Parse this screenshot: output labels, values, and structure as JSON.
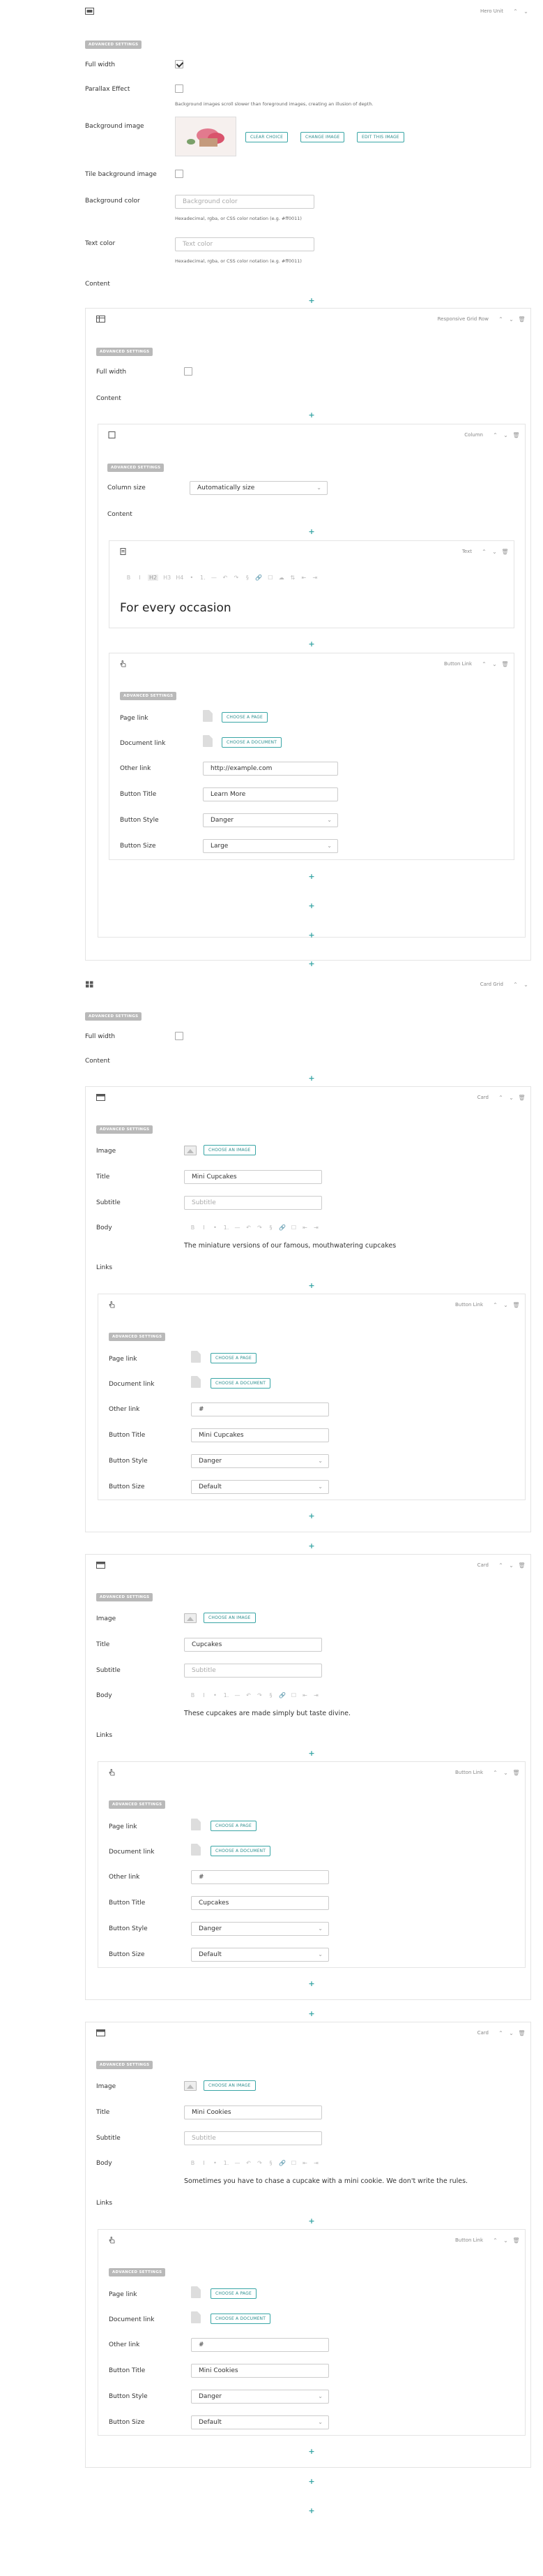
{
  "icons": {
    "controls": [
      "chevron-up-icon",
      "chevron-down-icon",
      "trash-icon"
    ]
  },
  "hero": {
    "type": "Hero Unit",
    "adv": "ADVANCED SETTINGS",
    "full_width": "Full width",
    "parallax": "Parallax Effect",
    "parallax_help": "Background images scroll slower than foreground images, creating an illusion of depth.",
    "bg_image": "Background image",
    "clear": "CLEAR CHOICE",
    "change": "CHANGE IMAGE",
    "edit": "EDIT THIS IMAGE",
    "tile": "Tile background image",
    "bg_color": "Background color",
    "bg_color_ph": "Background color",
    "color_help": "Hexadecimal, rgba, or CSS color notation (e.g. #ff0011)",
    "text_color": "Text color",
    "text_color_ph": "Text color",
    "text_help": "Hexadecimal, rgba, or CSS color notation (e.g. #ff0011)",
    "content": "Content"
  },
  "grid": {
    "type": "Responsive Grid Row",
    "adv": "ADVANCED SETTINGS",
    "full_width": "Full width",
    "content": "Content"
  },
  "column": {
    "type": "Column",
    "adv": "ADVANCED SETTINGS",
    "size_label": "Column size",
    "size_value": "Automatically size",
    "content": "Content"
  },
  "text": {
    "type": "Text",
    "toolbar": [
      "B",
      "I",
      "H2",
      "H3",
      "H4",
      "—",
      "•",
      "1.",
      "—",
      "↶",
      "↷",
      "§",
      "🔗",
      "☐",
      "☁",
      "⇅",
      "⇤",
      "⇥"
    ],
    "heading": "For every occasion"
  },
  "button1": {
    "type": "Button Link",
    "adv": "ADVANCED SETTINGS",
    "page_link": "Page link",
    "choose_page": "CHOOSE A PAGE",
    "doc_link": "Document link",
    "choose_doc": "CHOOSE A DOCUMENT",
    "other_link": "Other link",
    "other_value": "http://example.com",
    "title_label": "Button Title",
    "title_value": "Learn More",
    "style_label": "Button Style",
    "style_value": "Danger",
    "size_label": "Button Size",
    "size_value": "Large"
  },
  "cardgrid": {
    "type": "Card Grid",
    "adv": "ADVANCED SETTINGS",
    "full_width": "Full width",
    "content": "Content"
  },
  "cards": [
    {
      "type": "Card",
      "adv": "ADVANCED SETTINGS",
      "image": "Image",
      "choose_image": "CHOOSE AN IMAGE",
      "title_label": "Title",
      "title_value": "Mini Cupcakes",
      "subtitle_label": "Subtitle",
      "subtitle_ph": "Subtitle",
      "body_label": "Body",
      "body": "The miniature versions of our famous, mouthwatering cupcakes",
      "links": "Links",
      "button": {
        "type": "Button Link",
        "adv": "ADVANCED SETTINGS",
        "page_link": "Page link",
        "choose_page": "CHOOSE A PAGE",
        "doc_link": "Document link",
        "choose_doc": "CHOOSE A DOCUMENT",
        "other_link": "Other link",
        "other_value": "#",
        "title_label": "Button Title",
        "title_value": "Mini Cupcakes",
        "style_label": "Button Style",
        "style_value": "Danger",
        "size_label": "Button Size",
        "size_value": "Default"
      }
    },
    {
      "type": "Card",
      "adv": "ADVANCED SETTINGS",
      "image": "Image",
      "choose_image": "CHOOSE AN IMAGE",
      "title_label": "Title",
      "title_value": "Cupcakes",
      "subtitle_label": "Subtitle",
      "subtitle_ph": "Subtitle",
      "body_label": "Body",
      "body": "These cupcakes are made simply but taste divine.",
      "links": "Links",
      "button": {
        "type": "Button Link",
        "adv": "ADVANCED SETTINGS",
        "page_link": "Page link",
        "choose_page": "CHOOSE A PAGE",
        "doc_link": "Document link",
        "choose_doc": "CHOOSE A DOCUMENT",
        "other_link": "Other link",
        "other_value": "#",
        "title_label": "Button Title",
        "title_value": "Cupcakes",
        "style_label": "Button Style",
        "style_value": "Danger",
        "size_label": "Button Size",
        "size_value": "Default"
      }
    },
    {
      "type": "Card",
      "adv": "ADVANCED SETTINGS",
      "image": "Image",
      "choose_image": "CHOOSE AN IMAGE",
      "title_label": "Title",
      "title_value": "Mini Cookies",
      "subtitle_label": "Subtitle",
      "subtitle_ph": "Subtitle",
      "body_label": "Body",
      "body": "Sometimes you have to chase a cupcake with a mini cookie. We don't write the rules.",
      "links": "Links",
      "button": {
        "type": "Button Link",
        "adv": "ADVANCED SETTINGS",
        "page_link": "Page link",
        "choose_page": "CHOOSE A PAGE",
        "doc_link": "Document link",
        "choose_doc": "CHOOSE A DOCUMENT",
        "other_link": "Other link",
        "other_value": "#",
        "title_label": "Button Title",
        "title_value": "Mini Cookies",
        "style_label": "Button Style",
        "style_value": "Danger",
        "size_label": "Button Size",
        "size_value": "Default"
      }
    }
  ],
  "card_rtb": [
    "B",
    "I",
    "—",
    "•",
    "1.",
    "—",
    "↶",
    "↷",
    "§",
    "🔗",
    "☐",
    "⇅",
    "⇤",
    "⇥"
  ]
}
